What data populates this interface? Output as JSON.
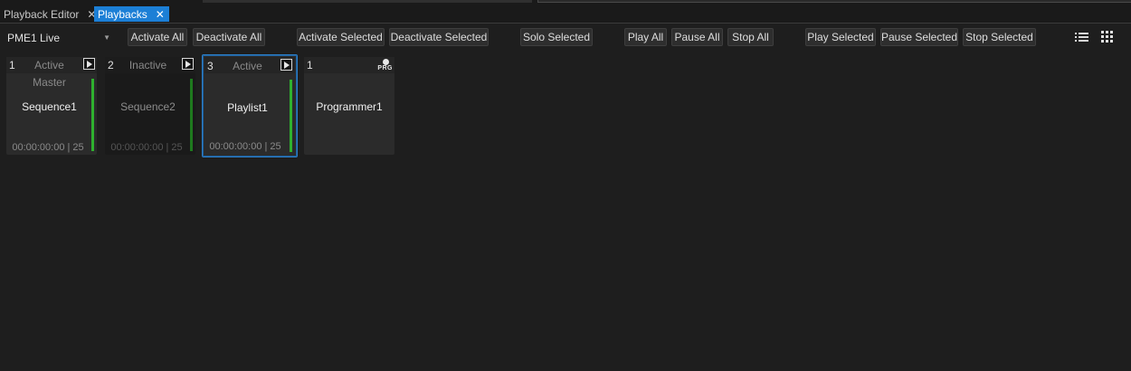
{
  "tabs": [
    {
      "label": "Playback Editor",
      "close": "✕",
      "active": false
    },
    {
      "label": "Playbacks",
      "close": "✕",
      "active": true
    }
  ],
  "toolbar": {
    "output_select": "PME1 Live",
    "activate_all": "Activate All",
    "deactivate_all": "Deactivate All",
    "activate_selected": "Activate Selected",
    "deactivate_selected": "Deactivate Selected",
    "solo_selected": "Solo Selected",
    "play_all": "Play All",
    "pause_all": "Pause All",
    "stop_all": "Stop All",
    "play_selected": "Play Selected",
    "pause_selected": "Pause Selected",
    "stop_selected": "Stop Selected",
    "view_list_icon": "list-view-icon",
    "view_grid_icon": "grid-view-icon"
  },
  "playbacks": [
    {
      "number": "1",
      "status": "Active",
      "subtitle": "Master",
      "name": "Sequence1",
      "timecode": "00:00:00:00 | 25",
      "level": 1.0
    },
    {
      "number": "2",
      "status": "Inactive",
      "subtitle": "",
      "name": "Sequence2",
      "timecode": "00:00:00:00 | 25",
      "level": 1.0
    },
    {
      "number": "3",
      "status": "Active",
      "subtitle": "",
      "name": "Playlist1",
      "timecode": "00:00:00:00 | 25",
      "level": 1.0
    }
  ],
  "programmer": {
    "number": "1",
    "name": "Programmer1",
    "badge": "PRG"
  },
  "colors": {
    "accent": "#1c7fd6",
    "level_active": "#2fb12f",
    "selection": "#2d7fc8"
  }
}
